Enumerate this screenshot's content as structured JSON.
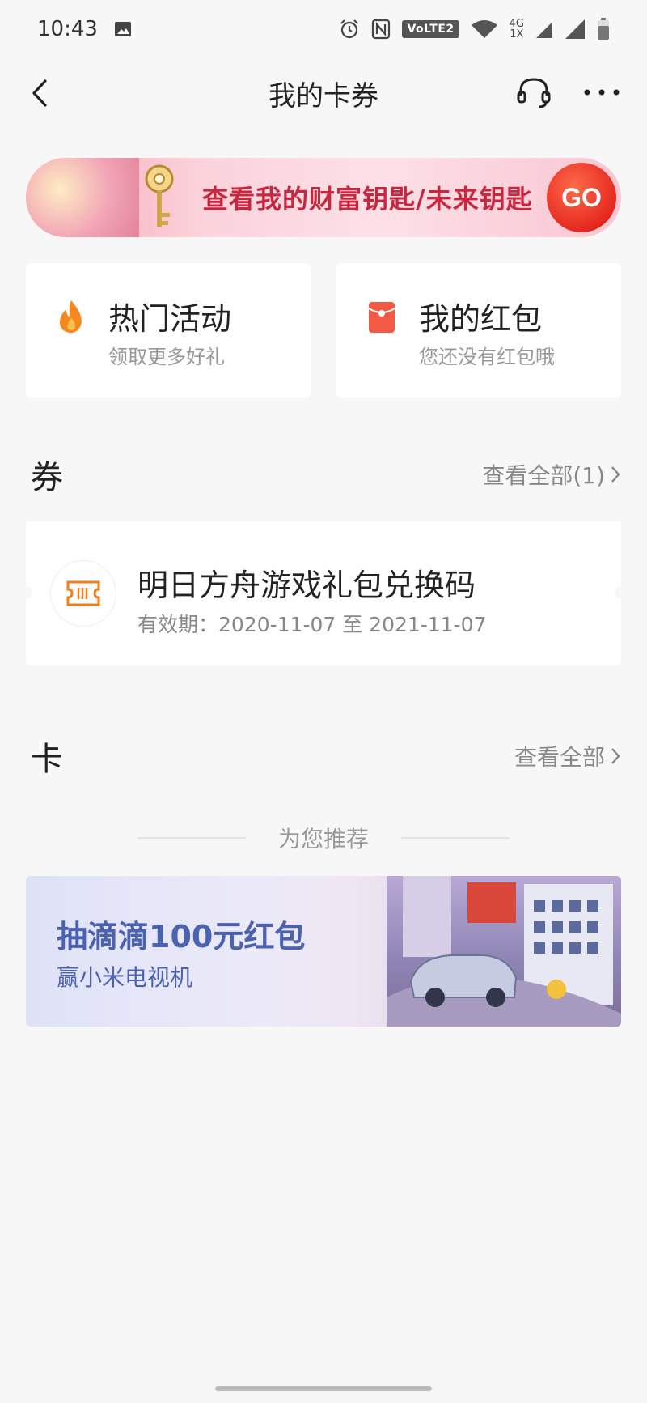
{
  "status_bar": {
    "time": "10:43",
    "volte": "VoLTE2",
    "network_top": "4G",
    "network_bottom": "1X"
  },
  "topbar": {
    "title": "我的卡券"
  },
  "banner": {
    "text": "查看我的财富钥匙/未来钥匙",
    "go_label": "GO"
  },
  "shortcuts": [
    {
      "title": "热门活动",
      "subtitle": "领取更多好礼",
      "icon": "flame-icon"
    },
    {
      "title": "我的红包",
      "subtitle": "您还没有红包哦",
      "icon": "red-packet-icon"
    }
  ],
  "coupons_section": {
    "title": "券",
    "view_all": "查看全部(1)"
  },
  "coupon": {
    "title": "明日方舟游戏礼包兑换码",
    "validity": "有效期：2020-11-07 至 2021-11-07",
    "icon": "ticket-icon"
  },
  "cards_section": {
    "title": "卡",
    "view_all": "查看全部"
  },
  "recommend": {
    "label": "为您推荐"
  },
  "promo": {
    "title": "抽滴滴100元红包",
    "subtitle": "赢小米电视机"
  },
  "colors": {
    "background": "#f7f7f7",
    "accent_orange": "#f07f1e",
    "accent_red": "#e5291f",
    "promo_blue": "#4b62b0"
  }
}
